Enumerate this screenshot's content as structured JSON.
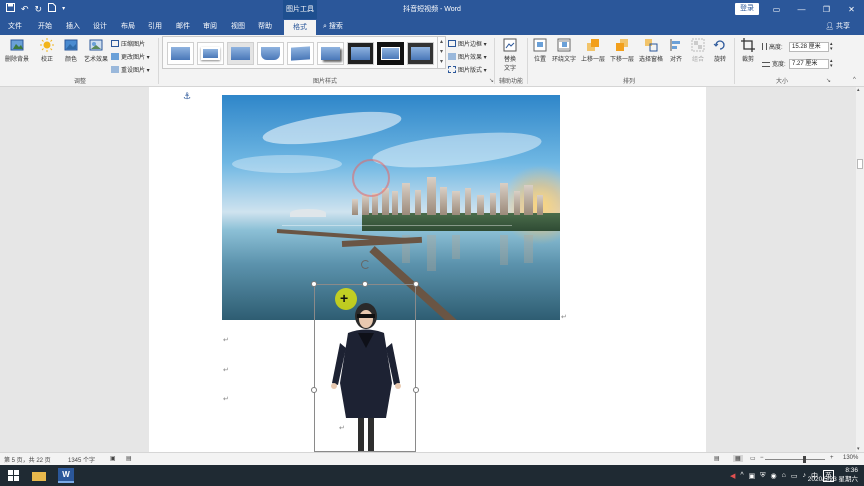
{
  "titlebar": {
    "context_tab": "图片工具",
    "document_title": "抖音短视频 - Word",
    "login_label": "登录",
    "qat": {
      "save": "save-icon",
      "undo": "undo-icon",
      "redo": "redo-icon",
      "new": "new-doc-icon"
    }
  },
  "tabs": {
    "items": [
      "文件",
      "开始",
      "插入",
      "设计",
      "布局",
      "引用",
      "邮件",
      "审阅",
      "视图",
      "帮助",
      "格式"
    ],
    "active": "格式",
    "search_label": "搜索",
    "share_label": "共享"
  },
  "ribbon": {
    "adjust": {
      "remove_bg": "删除背景",
      "correct": "校正",
      "color": "颜色",
      "art_effects": "艺术效果",
      "compress": "压缩图片",
      "change": "更改图片",
      "reset": "重设图片",
      "group_label": "调整"
    },
    "styles": {
      "border": "图片边框",
      "effects": "图片效果",
      "layout": "图片版式",
      "group_label": "图片样式"
    },
    "accessibility": {
      "alt_text_line1": "替换",
      "alt_text_line2": "文字",
      "group_label": "辅助功能"
    },
    "arrange": {
      "position": "位置",
      "wrap": "环绕文字",
      "bring_forward": "上移一层",
      "send_backward": "下移一层",
      "selection_pane": "选择窗格",
      "align": "对齐",
      "group": "组合",
      "rotate": "旋转",
      "group_label": "排列"
    },
    "size": {
      "crop": "裁剪",
      "height_label": "高度:",
      "height_value": "15.28 厘米",
      "width_label": "宽度:",
      "width_value": "7.27 厘米",
      "group_label": "大小"
    }
  },
  "status": {
    "page": "第 5 页，共 22 页",
    "words": "1345 个字",
    "zoom": "130%"
  },
  "taskbar": {
    "time": "8:36",
    "date": "2020/5/23 星期六",
    "ime": "中",
    "ime2": "英"
  },
  "colors": {
    "accent": "#2b579a",
    "ribbon_bg": "#f3f3f3",
    "workspace_bg": "#e6e6e6",
    "taskbar_bg": "#1f2a33"
  }
}
